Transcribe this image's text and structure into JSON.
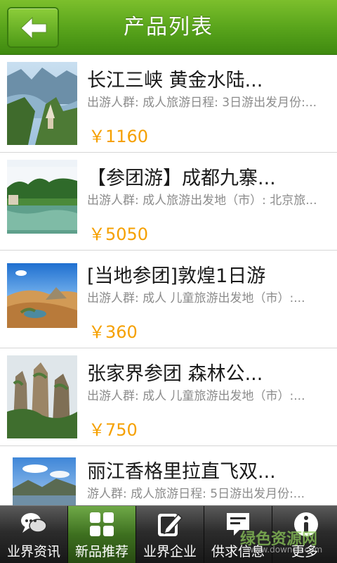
{
  "header": {
    "title": "产品列表",
    "back_icon": "arrow-left-icon"
  },
  "products": [
    {
      "title": "长江三峡 黄金水陆...",
      "desc": "出游人群: 成人旅游日程: 3日游出发月份:...",
      "price": "￥1160",
      "image": "three-gorges-scenery"
    },
    {
      "title": "【参团游】成都九寨...",
      "desc": "出游人群: 成人旅游出发地（市）: 北京旅...",
      "price": "￥5050",
      "image": "jiuzhai-lake-scenery"
    },
    {
      "title": "[当地参团]敦煌1日游",
      "desc": "出游人群: 成人 儿童旅游出发地（市）:...",
      "price": "￥360",
      "image": "dunhuang-desert-scenery"
    },
    {
      "title": "张家界参团 森林公...",
      "desc": "出游人群: 成人 儿童旅游出发地（市）:...",
      "price": "￥750",
      "image": "zhangjiajie-peaks-scenery"
    },
    {
      "title": "丽江香格里拉直飞双...",
      "desc": "游人群: 成人旅游日程: 5日游出发月份:...",
      "price": "",
      "image": "lijiang-shangrila-scenery"
    }
  ],
  "tabs": [
    {
      "label": "业界资讯",
      "icon": "speech-bubbles-icon",
      "active": false
    },
    {
      "label": "新品推荐",
      "icon": "grid-squares-icon",
      "active": true
    },
    {
      "label": "业界企业",
      "icon": "edit-note-icon",
      "active": false
    },
    {
      "label": "供求信息",
      "icon": "message-box-icon",
      "active": false
    },
    {
      "label": "更多",
      "icon": "info-icon",
      "active": false
    }
  ],
  "watermark": {
    "text": "绿色资源网",
    "url": "www.downcc.com"
  },
  "colors": {
    "header_green": "#5aa51c",
    "price_orange": "#f5a000",
    "tab_active": "#3d6f1f"
  }
}
